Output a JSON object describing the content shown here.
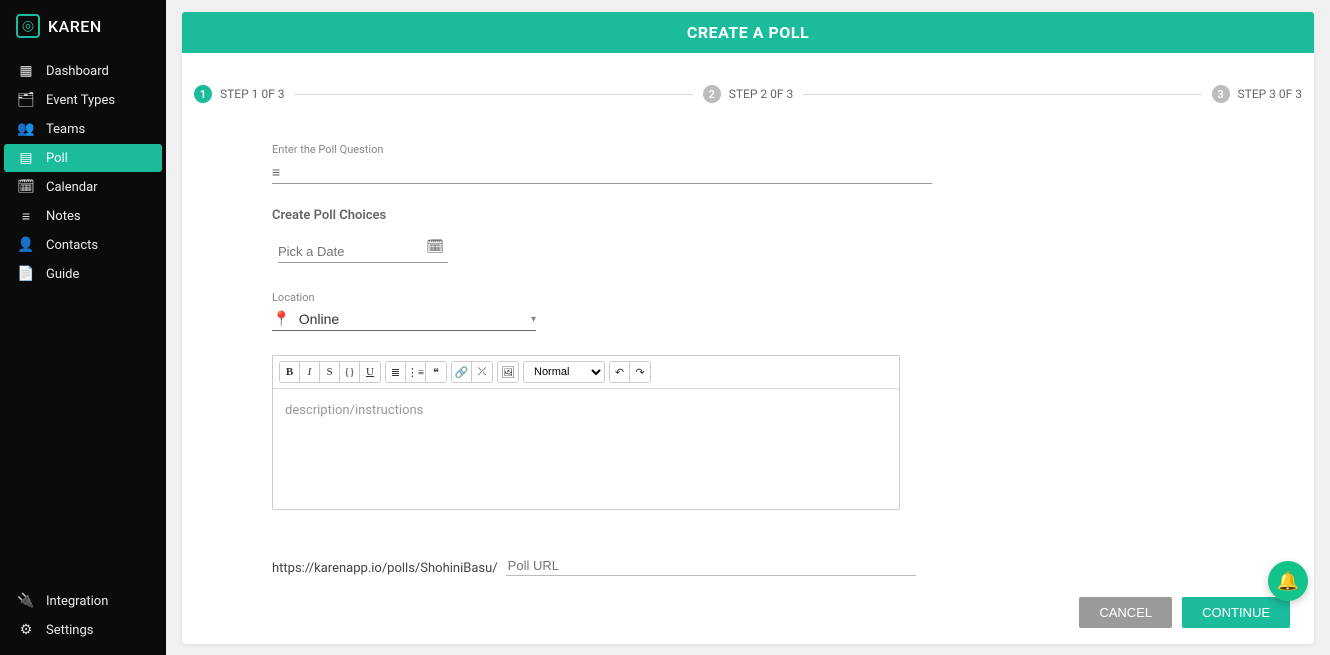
{
  "brand": {
    "name": "KAREN"
  },
  "sidebar": {
    "top": [
      {
        "label": "Dashboard",
        "icon": "▦"
      },
      {
        "label": "Event Types",
        "icon": "🗂"
      },
      {
        "label": "Teams",
        "icon": "👥"
      },
      {
        "label": "Poll",
        "icon": "▤"
      },
      {
        "label": "Calendar",
        "icon": "🗓"
      },
      {
        "label": "Notes",
        "icon": "≡"
      },
      {
        "label": "Contacts",
        "icon": "👤"
      },
      {
        "label": "Guide",
        "icon": "📄"
      }
    ],
    "bottom": [
      {
        "label": "Integration",
        "icon": "🔌"
      },
      {
        "label": "Settings",
        "icon": "⚙"
      }
    ],
    "activeIndex": 3
  },
  "header": {
    "title": "CREATE A POLL"
  },
  "stepper": {
    "steps": [
      {
        "num": "1",
        "label": "STEP 1 0F 3"
      },
      {
        "num": "2",
        "label": "STEP 2 0F 3"
      },
      {
        "num": "3",
        "label": "STEP 3 0F 3"
      }
    ],
    "activeStep": 0
  },
  "form": {
    "questionLabel": "Enter the Poll Question",
    "questionValue": "",
    "choicesLabel": "Create Poll Choices",
    "datePlaceholder": "Pick a Date",
    "locationLabel": "Location",
    "locationValue": "Online",
    "editorPlaceholder": "description/instructions",
    "formatNormal": "Normal",
    "urlPrefix": "https://karenapp.io/polls/ShohiniBasu/",
    "urlPlaceholder": "Poll URL"
  },
  "buttons": {
    "cancel": "CANCEL",
    "continue": "CONTINUE"
  },
  "colors": {
    "accent": "#1abc9c"
  }
}
